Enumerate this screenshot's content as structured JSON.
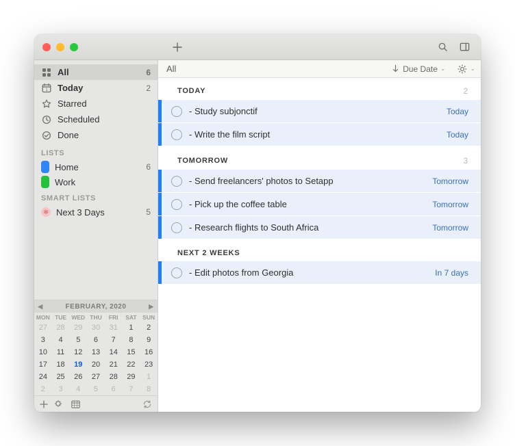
{
  "traffic": {
    "close": "#ff5f57",
    "min": "#febc2e",
    "max": "#28c840"
  },
  "sidebar": {
    "nav": [
      {
        "icon": "grid",
        "label": "All",
        "count": "6",
        "active": true
      },
      {
        "icon": "calendar",
        "label": "Today",
        "count": "2",
        "active": false,
        "bold": true
      },
      {
        "icon": "star",
        "label": "Starred",
        "count": "",
        "active": false
      },
      {
        "icon": "clock",
        "label": "Scheduled",
        "count": "",
        "active": false
      },
      {
        "icon": "check",
        "label": "Done",
        "count": "",
        "active": false
      }
    ],
    "lists_header": "LISTS",
    "lists": [
      {
        "color": "#2f86f6",
        "label": "Home",
        "count": "6"
      },
      {
        "color": "#25c03c",
        "label": "Work",
        "count": ""
      }
    ],
    "smart_header": "SMART LISTS",
    "smart": [
      {
        "label": "Next 3 Days",
        "count": "5"
      }
    ]
  },
  "calendar": {
    "title": "FEBRUARY, 2020",
    "dow": [
      "MON",
      "TUE",
      "WED",
      "THU",
      "FRI",
      "SAT",
      "SUN"
    ],
    "rows": [
      [
        {
          "n": "27",
          "dim": true
        },
        {
          "n": "28",
          "dim": true
        },
        {
          "n": "29",
          "dim": true
        },
        {
          "n": "30",
          "dim": true
        },
        {
          "n": "31",
          "dim": true
        },
        {
          "n": "1"
        },
        {
          "n": "2"
        }
      ],
      [
        {
          "n": "3"
        },
        {
          "n": "4"
        },
        {
          "n": "5"
        },
        {
          "n": "6"
        },
        {
          "n": "7"
        },
        {
          "n": "8"
        },
        {
          "n": "9"
        }
      ],
      [
        {
          "n": "10"
        },
        {
          "n": "11"
        },
        {
          "n": "12"
        },
        {
          "n": "13"
        },
        {
          "n": "14"
        },
        {
          "n": "15"
        },
        {
          "n": "16"
        }
      ],
      [
        {
          "n": "17"
        },
        {
          "n": "18"
        },
        {
          "n": "19",
          "today": true
        },
        {
          "n": "20"
        },
        {
          "n": "21"
        },
        {
          "n": "22"
        },
        {
          "n": "23"
        }
      ],
      [
        {
          "n": "24"
        },
        {
          "n": "25"
        },
        {
          "n": "26"
        },
        {
          "n": "27"
        },
        {
          "n": "28"
        },
        {
          "n": "29"
        },
        {
          "n": "1",
          "dim": true
        }
      ],
      [
        {
          "n": "2",
          "dim": true
        },
        {
          "n": "3",
          "dim": true
        },
        {
          "n": "4",
          "dim": true
        },
        {
          "n": "5",
          "dim": true
        },
        {
          "n": "6",
          "dim": true
        },
        {
          "n": "7",
          "dim": true
        },
        {
          "n": "8",
          "dim": true
        }
      ]
    ]
  },
  "content": {
    "title": "All",
    "sort_label": "Due Date",
    "groups": [
      {
        "title": "TODAY",
        "count": "2",
        "tasks": [
          {
            "text": "- Study subjonctif",
            "due": "Today"
          },
          {
            "text": "- Write the film script",
            "due": "Today"
          }
        ]
      },
      {
        "title": "TOMORROW",
        "count": "3",
        "tasks": [
          {
            "text": "- Send freelancers' photos to Setapp",
            "due": "Tomorrow"
          },
          {
            "text": "- Pick up the coffee table",
            "due": "Tomorrow"
          },
          {
            "text": "- Research flights to South Africa",
            "due": "Tomorrow"
          }
        ]
      },
      {
        "title": "NEXT 2 WEEKS",
        "count": "",
        "tasks": [
          {
            "text": "- Edit photos from Georgia",
            "due": "In 7 days"
          }
        ]
      }
    ]
  }
}
